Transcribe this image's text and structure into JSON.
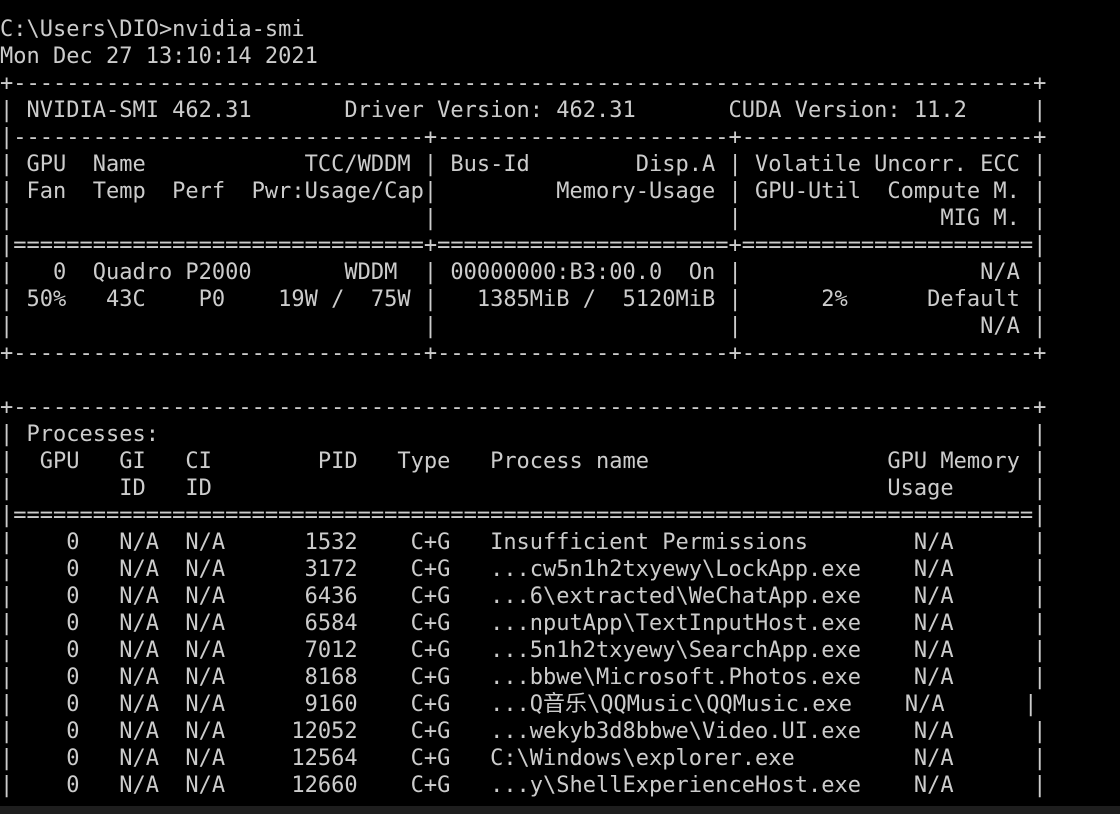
{
  "console": {
    "background": "#000000",
    "foreground": "#cccccc",
    "prompt": "C:\\Users\\DIO>nvidia-smi",
    "timestamp": "Mon Dec 27 13:10:14 2021"
  },
  "smi": {
    "border_top": "+-----------------------------------------------------------------------------+",
    "header_line": "| NVIDIA-SMI 462.31       Driver Version: 462.31       CUDA Version: 11.2     |",
    "header_sep": "|-------------------------------+----------------------+----------------------+",
    "cols1": "| GPU  Name            TCC/WDDM | Bus-Id        Disp.A | Volatile Uncorr. ECC |",
    "cols2": "| Fan  Temp  Perf  Pwr:Usage/Cap|         Memory-Usage | GPU-Util  Compute M. |",
    "cols3": "|                               |                      |               MIG M. |",
    "cols_sep": "|===============================+======================+======================|",
    "gpu_row1": "|   0  Quadro P2000       WDDM  | 00000000:B3:00.0  On |                  N/A |",
    "gpu_row2": "| 50%   43C    P0    19W /  75W |   1385MiB /  5120MiB |      2%      Default |",
    "gpu_row3": "|                               |                      |                  N/A |",
    "border_bottom": "+-------------------------------+----------------------+----------------------+"
  },
  "processes": {
    "border_top": "+-----------------------------------------------------------------------------+",
    "title": "| Processes:                                                                  |",
    "cols1": "|  GPU   GI   CI        PID   Type   Process name                  GPU Memory |",
    "cols2": "|        ID   ID                                                   Usage      |",
    "cols_sep": "|=============================================================================|",
    "rows": [
      "|    0   N/A  N/A      1532    C+G   Insufficient Permissions        N/A      |",
      "|    0   N/A  N/A      3172    C+G   ...cw5n1h2txyewy\\LockApp.exe    N/A      |",
      "|    0   N/A  N/A      6436    C+G   ...6\\extracted\\WeChatApp.exe    N/A      |",
      "|    0   N/A  N/A      6584    C+G   ...nputApp\\TextInputHost.exe    N/A      |",
      "|    0   N/A  N/A      7012    C+G   ...5n1h2txyewy\\SearchApp.exe    N/A      |",
      "|    0   N/A  N/A      8168    C+G   ...bbwe\\Microsoft.Photos.exe    N/A      |",
      "|    0   N/A  N/A      9160    C+G   ...Q音乐\\QQMusic\\QQMusic.exe    N/A      |",
      "|    0   N/A  N/A     12052    C+G   ...wekyb3d8bbwe\\Video.UI.exe    N/A      |",
      "|    0   N/A  N/A     12564    C+G   C:\\Windows\\explorer.exe         N/A      |",
      "|    0   N/A  N/A     12660    C+G   ...y\\ShellExperienceHost.exe    N/A      |"
    ]
  }
}
